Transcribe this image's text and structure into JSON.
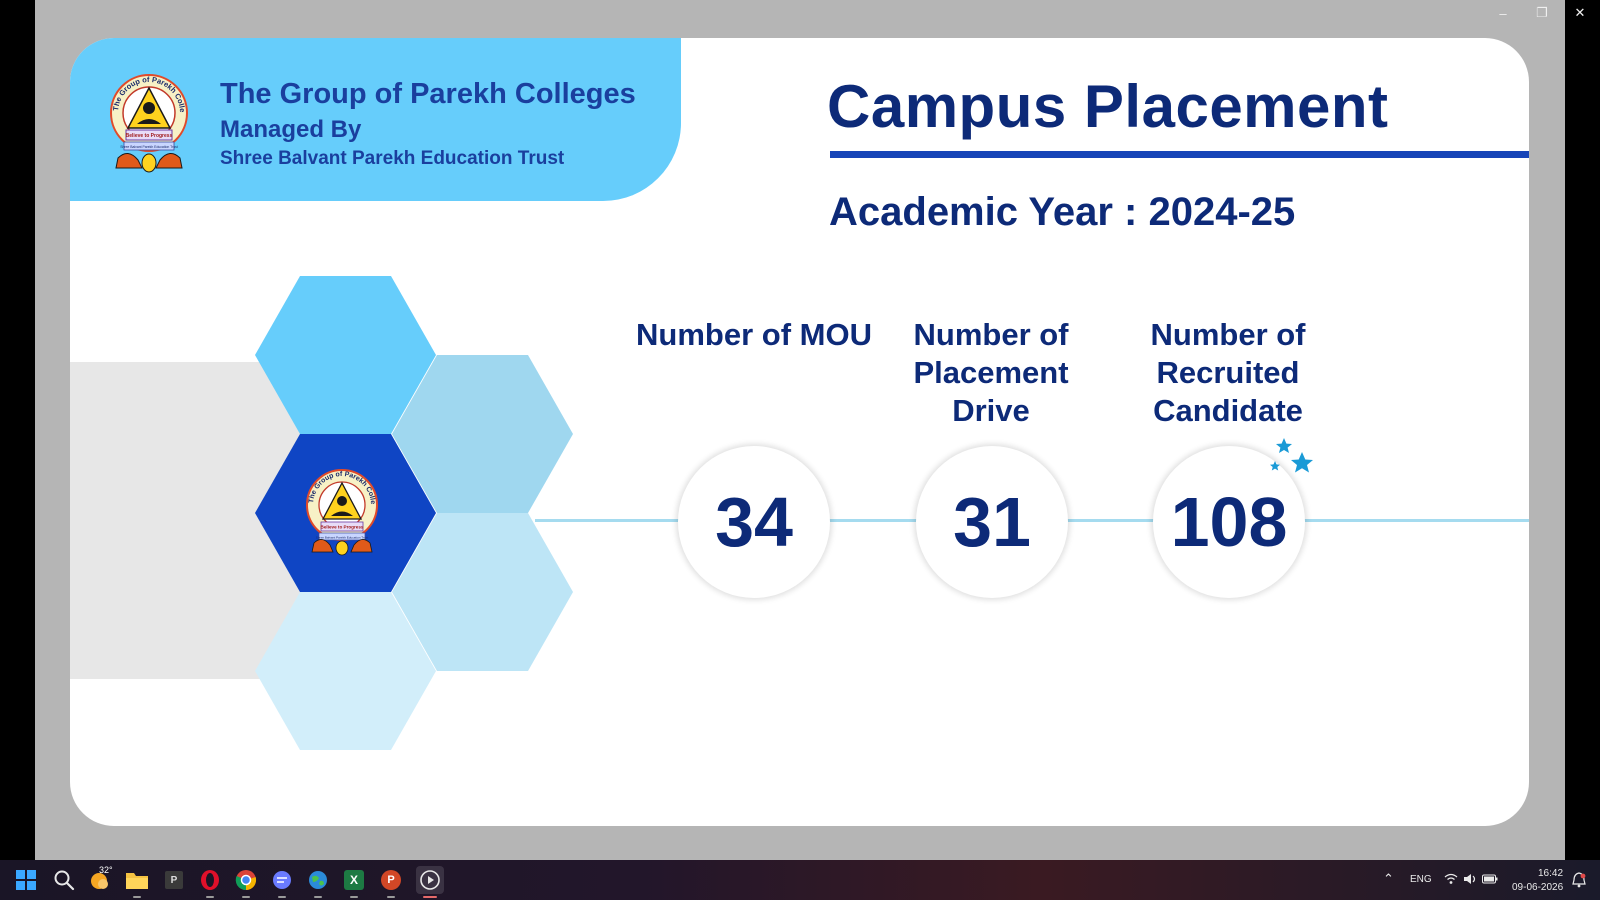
{
  "window": {
    "minimize_glyph": "–",
    "restore_glyph": "❐",
    "close_glyph": "✕"
  },
  "header": {
    "college_name": "The Group of Parekh Colleges",
    "managed_by": "Managed By",
    "trust_name": "Shree Balvant Parekh Education Trust"
  },
  "logo": {
    "ring_text": "The Group of Parekh Colleges - Mahuva",
    "motto": "Believe to Progress",
    "trust": "Shree Balvant Parekh Education Trust"
  },
  "title": "Campus Placement",
  "academic_year": "Academic Year : 2024-25",
  "stats": [
    {
      "label": "Number of MOU",
      "value": "34"
    },
    {
      "label": "Number of Placement Drive",
      "value": "31"
    },
    {
      "label": "Number of Recruited Candidate",
      "value": "108"
    }
  ],
  "colors": {
    "primary_blue": "#0d2a78",
    "accent_blue": "#1745b8",
    "banner_blue": "#66cdfb",
    "hex_light_1": "#66cdfb",
    "hex_light_2": "#9fd7ef",
    "hex_light_3": "#bde5f6",
    "hex_light_4": "#d2eefa",
    "hex_dark": "#0f45c4",
    "star_blue": "#1a9ad6"
  },
  "taskbar": {
    "apps": [
      {
        "name": "start-button",
        "icon": "windows-logo-icon"
      },
      {
        "name": "search-button",
        "icon": "search-icon"
      },
      {
        "name": "weather-widget",
        "icon": "weather-icon"
      },
      {
        "name": "file-explorer",
        "icon": "folder-icon"
      },
      {
        "name": "app-p",
        "icon": "p-app-icon"
      },
      {
        "name": "opera",
        "icon": "opera-icon"
      },
      {
        "name": "chrome",
        "icon": "chrome-icon"
      },
      {
        "name": "chat-app",
        "icon": "chat-icon"
      },
      {
        "name": "browser-globe",
        "icon": "globe-icon"
      },
      {
        "name": "excel",
        "icon": "excel-icon"
      },
      {
        "name": "powerpoint",
        "icon": "powerpoint-icon"
      },
      {
        "name": "media-player",
        "icon": "play-icon"
      }
    ],
    "weather_temp": "32°",
    "p_app_letter": "P",
    "excel_letter": "X",
    "ppt_letter": "P",
    "language": "ENG",
    "time": "16:42",
    "date": "09-06-2026"
  }
}
